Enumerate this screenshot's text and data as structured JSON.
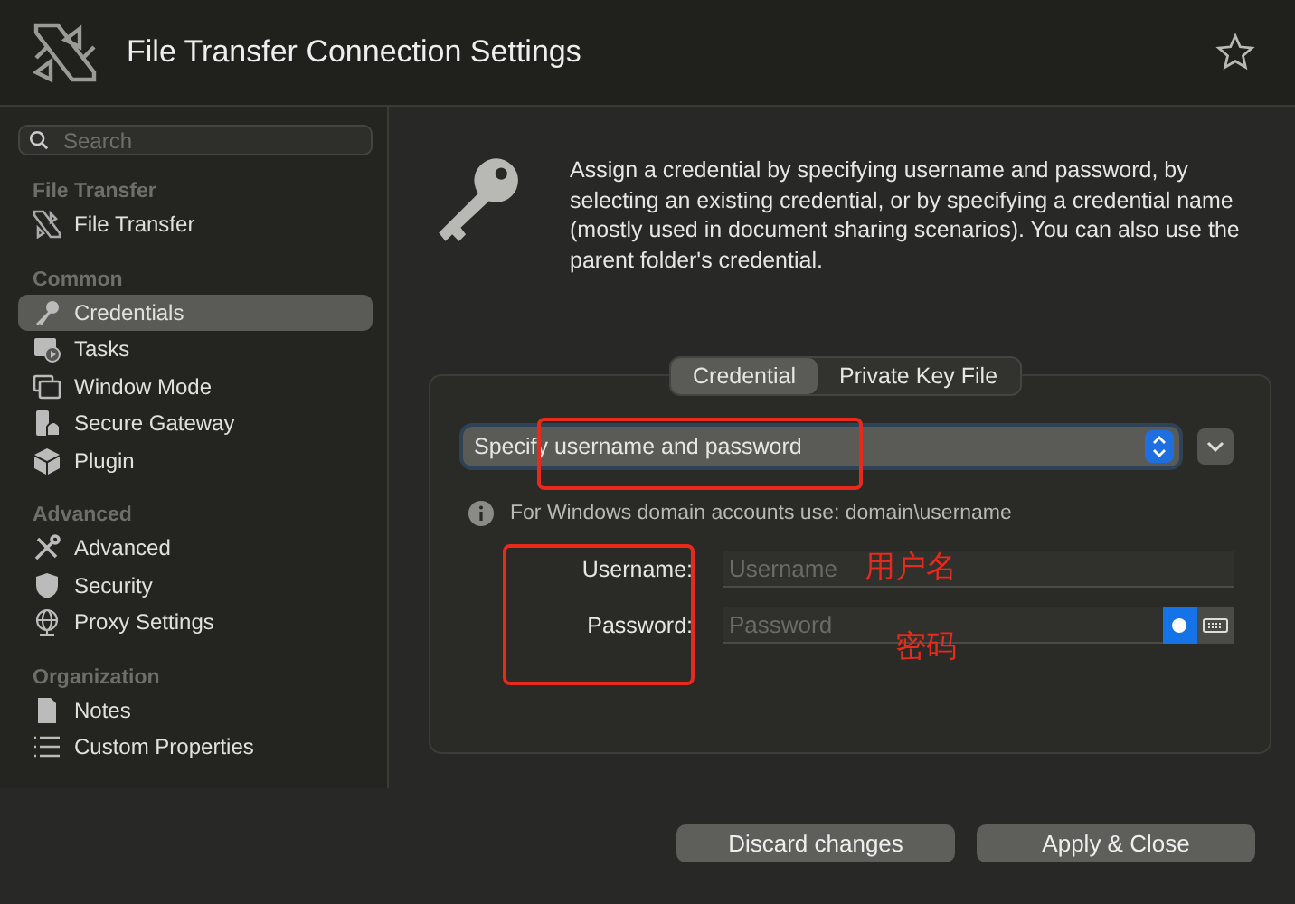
{
  "window": {
    "title": "File Transfer Connection Settings"
  },
  "sidebar": {
    "search": {
      "placeholder": "Search"
    },
    "sections": [
      {
        "title": "File Transfer",
        "items": [
          {
            "label": "File Transfer",
            "selected": false
          }
        ]
      },
      {
        "title": "Common",
        "items": [
          {
            "label": "Credentials",
            "selected": true
          },
          {
            "label": "Tasks",
            "selected": false
          },
          {
            "label": "Window Mode",
            "selected": false
          },
          {
            "label": "Secure Gateway",
            "selected": false
          },
          {
            "label": "Plugin",
            "selected": false
          }
        ]
      },
      {
        "title": "Advanced",
        "items": [
          {
            "label": "Advanced",
            "selected": false
          },
          {
            "label": "Security",
            "selected": false
          },
          {
            "label": "Proxy Settings",
            "selected": false
          }
        ]
      },
      {
        "title": "Organization",
        "items": [
          {
            "label": "Notes",
            "selected": false
          },
          {
            "label": "Custom Properties",
            "selected": false
          }
        ]
      }
    ]
  },
  "description": "Assign a credential by specifying username and password, by selecting an existing credential, or by specifying a credential name (mostly used in document sharing scenarios). You can also use the parent folder's credential.",
  "tabs": [
    {
      "label": "Credential",
      "selected": true
    },
    {
      "label": "Private Key File",
      "selected": false
    }
  ],
  "credential_type": {
    "value": "Specify username and password"
  },
  "hint": "For Windows domain accounts use: domain\\username",
  "fields": [
    {
      "label": "Username:",
      "placeholder": "Username",
      "kind": "text"
    },
    {
      "label": "Password:",
      "placeholder": "Password",
      "kind": "password"
    }
  ],
  "password_mode": [
    {
      "kind": "dot",
      "selected": true
    },
    {
      "kind": "keyboard",
      "selected": false
    }
  ],
  "annotations": [
    {
      "kind": "box"
    },
    {
      "kind": "box"
    },
    {
      "kind": "note",
      "text": "用户名"
    },
    {
      "kind": "note",
      "text": "密码"
    }
  ],
  "buttons": [
    "Discard changes",
    "Apply & Close"
  ]
}
